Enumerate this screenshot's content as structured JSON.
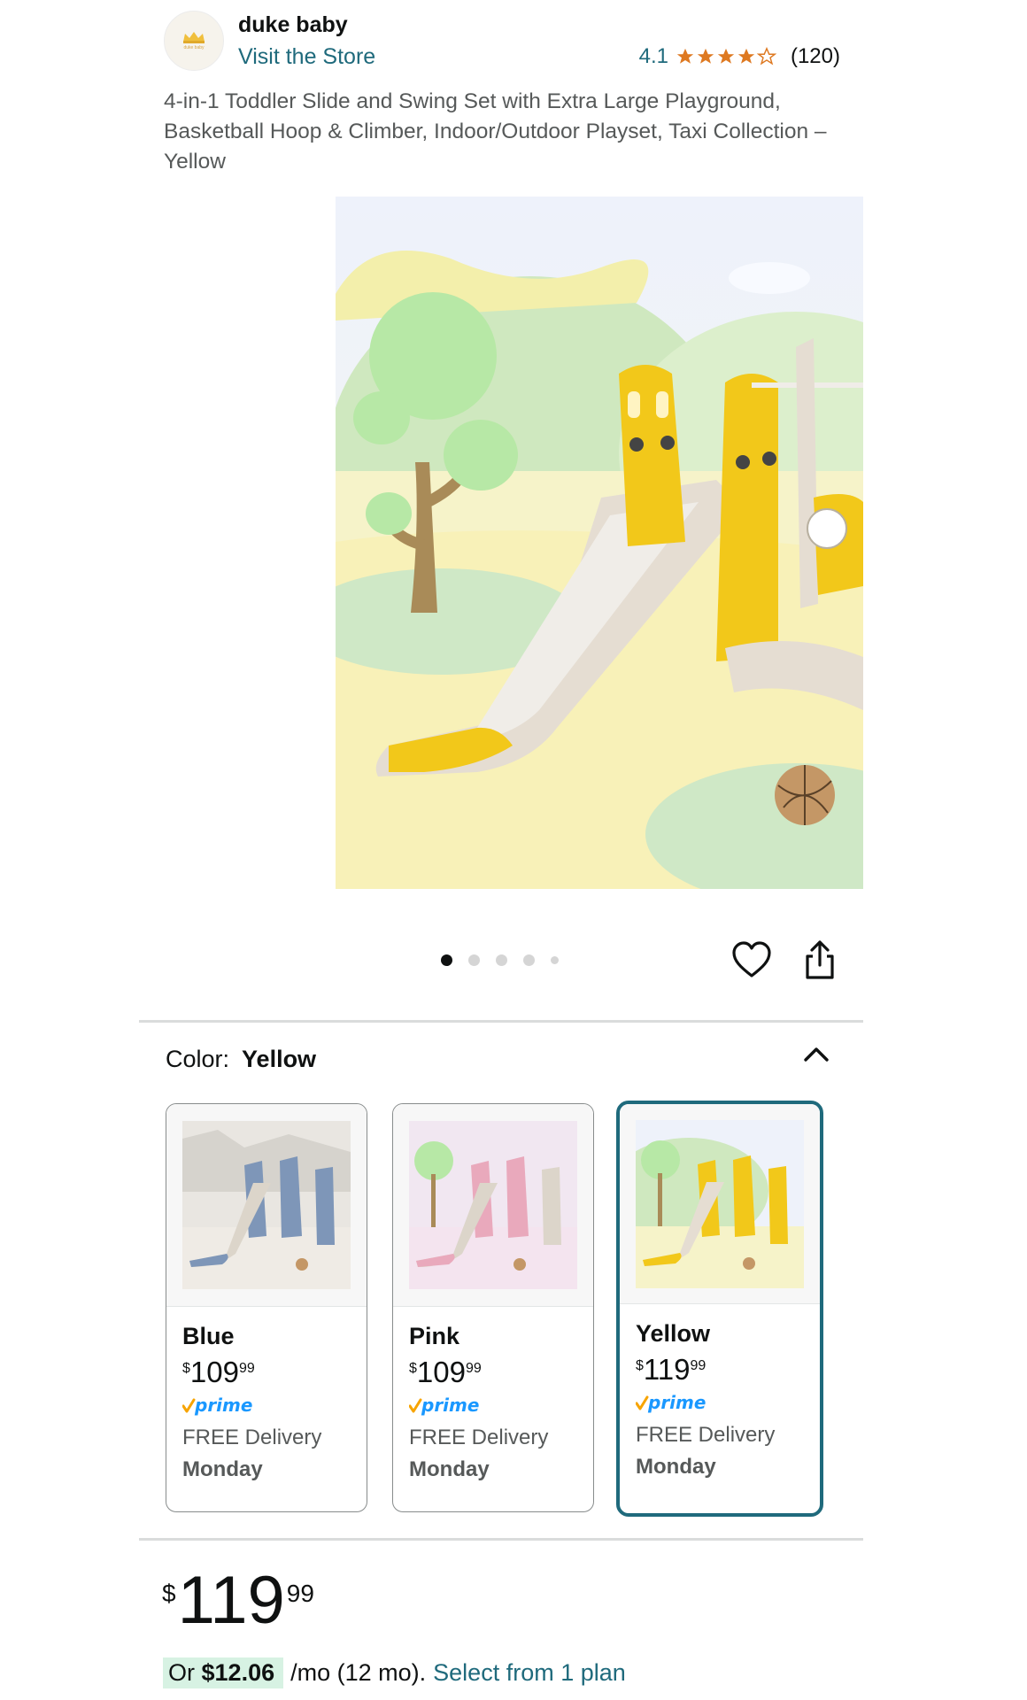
{
  "store": {
    "name": "duke baby",
    "visit_label": "Visit the Store",
    "logo_icon": "crown-logo-icon",
    "logo_text": "duke baby"
  },
  "rating": {
    "value": "4.1",
    "stars": 4.1,
    "count": "(120)",
    "star_color": "#de7921"
  },
  "product": {
    "title": "4-in-1 Toddler Slide and Swing Set with Extra Large Playground, Basketball Hoop & Climber, Indoor/Outdoor Playset, Taxi Collection – Yellow"
  },
  "gallery": {
    "image_count": 5,
    "active_index": 0,
    "favorite_icon": "heart-icon",
    "share_icon": "share-icon"
  },
  "color_selector": {
    "label": "Color:",
    "selected": "Yellow",
    "collapse_icon": "chevron-up-icon",
    "options": [
      {
        "name": "Blue",
        "price_symbol": "$",
        "price_whole": "109",
        "price_fraction": "99",
        "prime": "prime",
        "delivery": "FREE Delivery",
        "delivery_day": "Monday",
        "accent": "#7e96b8"
      },
      {
        "name": "Pink",
        "price_symbol": "$",
        "price_whole": "109",
        "price_fraction": "99",
        "prime": "prime",
        "delivery": "FREE Delivery",
        "delivery_day": "Monday",
        "accent": "#e9a9bc"
      },
      {
        "name": "Yellow",
        "price_symbol": "$",
        "price_whole": "119",
        "price_fraction": "99",
        "prime": "prime",
        "delivery": "FREE Delivery",
        "delivery_day": "Monday",
        "accent": "#f2c81a"
      }
    ]
  },
  "price": {
    "symbol": "$",
    "whole": "119",
    "fraction": "99"
  },
  "financing": {
    "prefix": "Or",
    "amount": "$12.06",
    "term": "/mo (12 mo).",
    "link": "Select from 1 plan"
  },
  "colors": {
    "link": "#1f6a7c",
    "selected_border": "#1f6a7c",
    "prime_blue": "#1a98ff",
    "prime_check": "#f7a400",
    "financing_highlight": "#d7f2e3"
  }
}
